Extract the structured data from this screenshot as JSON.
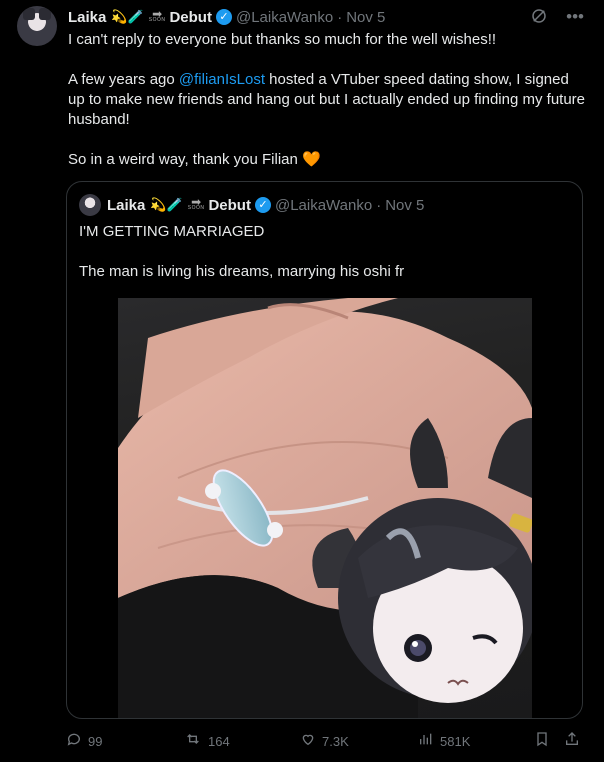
{
  "tweet": {
    "author_name": "Laika",
    "author_emojis": "💫🧪",
    "soon_label": "SOON",
    "debut_label": "Debut",
    "handle": "@LaikaWanko",
    "separator": "·",
    "date": "Nov 5",
    "text_p1": "I can't reply to everyone but thanks so much for the well wishes!!",
    "text_p2_before": "A few years ago ",
    "text_p2_link": "@filianIsLost",
    "text_p2_after": " hosted a VTuber speed dating show, I signed up to make new friends and hang out but I actually ended up finding my future husband!",
    "text_p3": "So in a weird way, thank you Filian",
    "text_p3_emoji": "🧡"
  },
  "quoted": {
    "author_name": "Laika",
    "author_emojis": "💫🧪",
    "soon_label": "SOON",
    "debut_label": "Debut",
    "handle": "@LaikaWanko",
    "separator": "·",
    "date": "Nov 5",
    "line1": "I'M GETTING MARRIAGED",
    "line2": "The man is living his dreams, marrying his oshi fr"
  },
  "actions": {
    "replies": "99",
    "reposts": "164",
    "likes": "7.3K",
    "views": "581K"
  },
  "colors": {
    "link": "#1d9bf0",
    "muted": "#71767b",
    "verified": "#1d9bf0",
    "background": "#000000"
  },
  "icons": [
    "grok-icon",
    "more-icon",
    "verified-icon",
    "reply-icon",
    "repost-icon",
    "like-icon",
    "views-icon",
    "bookmark-icon",
    "share-icon"
  ]
}
